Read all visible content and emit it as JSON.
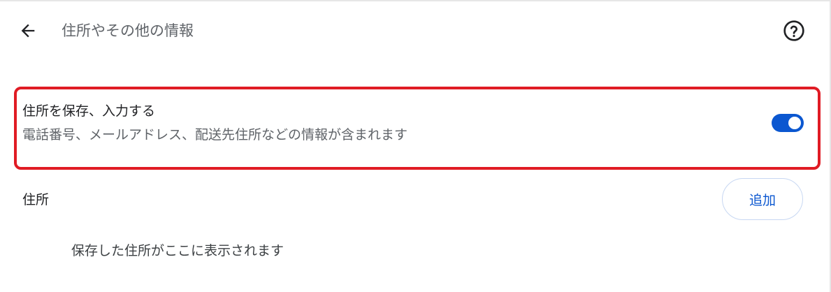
{
  "header": {
    "title": "住所やその他の情報",
    "back_icon": "arrow-left-icon",
    "help_icon": "help-circle-icon"
  },
  "autofill_setting": {
    "title": "住所を保存、入力する",
    "description": "電話番号、メールアドレス、配送先住所などの情報が含まれます",
    "enabled": true
  },
  "addresses": {
    "label": "住所",
    "add_button": "追加",
    "empty_message": "保存した住所がここに表示されます"
  },
  "colors": {
    "accent": "#0b57d0",
    "highlight": "#e01b24"
  }
}
